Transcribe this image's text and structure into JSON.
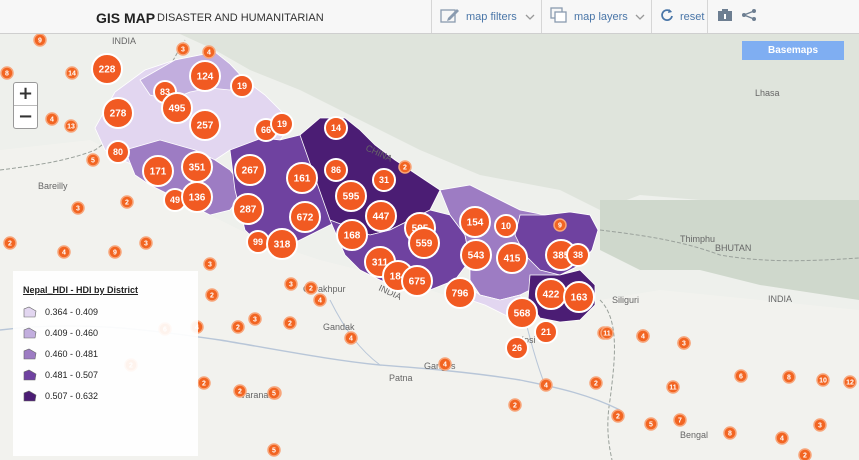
{
  "header": {
    "brand": "GIS MAP",
    "subtitle": "DISASTER AND HUMANITARIAN",
    "map_filters": "map filters",
    "map_layers": "map layers",
    "reset": "reset"
  },
  "controls": {
    "zoom_in": "+",
    "zoom_out": "−",
    "basemaps": "Basemaps"
  },
  "legend": {
    "title": "Nepal_HDI - HDI by District",
    "classes": [
      {
        "label": "0.364 - 0.409",
        "color": "#e2d6f0"
      },
      {
        "label": "0.409 - 0.460",
        "color": "#c2aede"
      },
      {
        "label": "0.460 - 0.481",
        "color": "#9d7cc3"
      },
      {
        "label": "0.481 - 0.507",
        "color": "#6f42a0"
      },
      {
        "label": "0.507 - 0.632",
        "color": "#4b1d74"
      }
    ]
  },
  "place_labels": [
    "INDIA",
    "Lhasa",
    "Bareilly",
    "CHINA",
    "Gorakhpur",
    "INDIA",
    "Patna",
    "Thimphu",
    "BHUTAN",
    "INDIA",
    "Siliguri",
    "Ganges",
    "Kosi",
    "Gandak",
    "Varanasi",
    "Bengal"
  ],
  "large_clusters": [
    "228",
    "124",
    "83",
    "19",
    "495",
    "278",
    "257",
    "66",
    "19",
    "80",
    "171",
    "351",
    "267",
    "161",
    "86",
    "14",
    "595",
    "31",
    "49",
    "136",
    "287",
    "672",
    "447",
    "154",
    "10",
    "168",
    "595",
    "559",
    "99",
    "318",
    "543",
    "415",
    "385",
    "38",
    "311",
    "184",
    "675",
    "796",
    "422",
    "163",
    "568",
    "21",
    "26"
  ],
  "small_clusters": [
    "9",
    "3",
    "4",
    "8",
    "14",
    "4",
    "13",
    "5",
    "2",
    "3",
    "9",
    "4",
    "2",
    "3",
    "2",
    "3",
    "3",
    "2",
    "4",
    "2",
    "3",
    "2",
    "6",
    "4",
    "2",
    "2",
    "5",
    "2",
    "4",
    "4",
    "2",
    "5",
    "2",
    "3",
    "2",
    "4",
    "2",
    "2",
    "9",
    "11",
    "4",
    "3",
    "6",
    "8",
    "10",
    "12",
    "5",
    "11",
    "7",
    "5",
    "8",
    "4",
    "3",
    "5",
    "2"
  ]
}
